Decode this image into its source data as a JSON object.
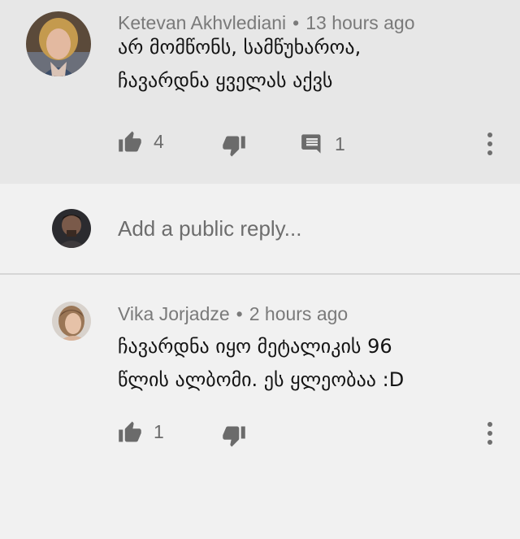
{
  "comment": {
    "author": "Ketevan Akhvlediani",
    "time": "13 hours ago",
    "line1": "არ მომწონს, სამწუხაროა,",
    "line2": "ჩავარდნა ყველას აქვს",
    "likes": "4",
    "replies": "1"
  },
  "reply_box": {
    "placeholder": "Add a public reply..."
  },
  "reply": {
    "author": "Vika Jorjadze",
    "time": "2 hours ago",
    "line1": "ჩავარდნა იყო მეტალიკის 96",
    "line2": "წლის ალბომი. ეს ყლეობაა :D",
    "likes": "1"
  },
  "separator": "•",
  "icons": [
    "thumb-up-icon",
    "thumb-down-icon",
    "reply-comment-icon",
    "more-vert-icon"
  ]
}
